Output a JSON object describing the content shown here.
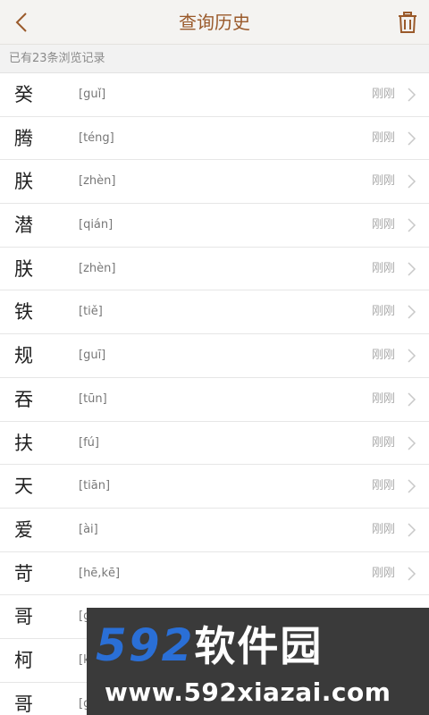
{
  "header": {
    "title": "查询历史",
    "back_icon": "chevron-left-icon",
    "trash_icon": "trash-icon"
  },
  "summary": {
    "text": "已有23条浏览记录"
  },
  "colors": {
    "accent": "#9a5a2b",
    "header_bg": "#f4f3f1"
  },
  "items": [
    {
      "char": "癸",
      "pinyin": "[guǐ]",
      "time": "刚刚"
    },
    {
      "char": "腾",
      "pinyin": "[téng]",
      "time": "刚刚"
    },
    {
      "char": "朕",
      "pinyin": "[zhèn]",
      "time": "刚刚"
    },
    {
      "char": "潜",
      "pinyin": "[qián]",
      "time": "刚刚"
    },
    {
      "char": "朕",
      "pinyin": "[zhèn]",
      "time": "刚刚"
    },
    {
      "char": "铁",
      "pinyin": "[tiě]",
      "time": "刚刚"
    },
    {
      "char": "规",
      "pinyin": "[guī]",
      "time": "刚刚"
    },
    {
      "char": "吞",
      "pinyin": "[tūn]",
      "time": "刚刚"
    },
    {
      "char": "扶",
      "pinyin": "[fú]",
      "time": "刚刚"
    },
    {
      "char": "天",
      "pinyin": "[tiān]",
      "time": "刚刚"
    },
    {
      "char": "爱",
      "pinyin": "[ài]",
      "time": "刚刚"
    },
    {
      "char": "苛",
      "pinyin": "[hē,kē]",
      "time": "刚刚"
    },
    {
      "char": "哥",
      "pinyin": "[g",
      "time": ""
    },
    {
      "char": "柯",
      "pinyin": "[k",
      "time": ""
    },
    {
      "char": "哥",
      "pinyin": "[g",
      "time": ""
    }
  ],
  "watermark": {
    "logo_num": "592",
    "logo_cn": "软件园",
    "url": "www.592xiazai.com"
  }
}
